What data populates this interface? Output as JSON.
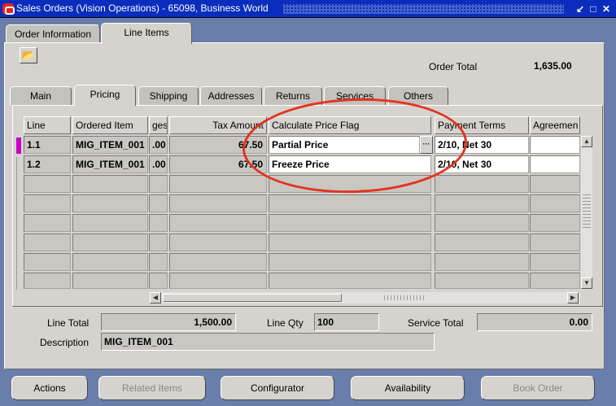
{
  "window": {
    "title": "Sales Orders (Vision Operations) - 65098, Business World",
    "min_glyph": "↙",
    "max_glyph": "□",
    "close_glyph": "✕"
  },
  "top_tabs": [
    {
      "label": "Order Information",
      "active": false
    },
    {
      "label": "Line Items",
      "active": true
    }
  ],
  "order_total": {
    "label": "Order Total",
    "value": "1,635.00"
  },
  "sub_tabs": [
    {
      "label": "Main",
      "active": false
    },
    {
      "label": "Pricing",
      "active": true
    },
    {
      "label": "Shipping",
      "active": false
    },
    {
      "label": "Addresses",
      "active": false
    },
    {
      "label": "Returns",
      "active": false
    },
    {
      "label": "Services",
      "active": false
    },
    {
      "label": "Others",
      "active": false
    }
  ],
  "grid": {
    "headers": {
      "line": "Line",
      "ordered_item": "Ordered Item",
      "charges": "ges",
      "tax_amount": "Tax Amount",
      "calc_price_flag": "Calculate Price Flag",
      "payment_terms": "Payment Terms",
      "agreement": "Agreemen"
    },
    "rows": [
      {
        "line": "1.1",
        "ordered_item": "MIG_ITEM_001",
        "charges": ".00",
        "tax_amount": "67.50",
        "calc_price_flag": "Partial Price",
        "payment_terms": "2/10, Net 30",
        "agreement": ""
      },
      {
        "line": "1.2",
        "ordered_item": "MIG_ITEM_001",
        "charges": ".00",
        "tax_amount": "67.50",
        "calc_price_flag": "Freeze Price",
        "payment_terms": "2/10, Net 30",
        "agreement": ""
      }
    ],
    "lov_glyph": "···"
  },
  "totals": {
    "line_total_label": "Line Total",
    "line_total": "1,500.00",
    "line_qty_label": "Line Qty",
    "line_qty": "100",
    "service_total_label": "Service Total",
    "service_total": "0.00",
    "description_label": "Description",
    "description": "MIG_ITEM_001"
  },
  "buttons": [
    {
      "label": "Actions",
      "enabled": true
    },
    {
      "label": "Related Items",
      "enabled": false
    },
    {
      "label": "Configurator",
      "enabled": true
    },
    {
      "label": "Availability",
      "enabled": true
    },
    {
      "label": "Book Order",
      "enabled": false
    }
  ],
  "colors": {
    "title_bar": "#0a2dbe",
    "background": "#6a7eab",
    "panel": "#d6d3ce",
    "annotation": "#e23420",
    "row_indicator": "#c800c8"
  }
}
